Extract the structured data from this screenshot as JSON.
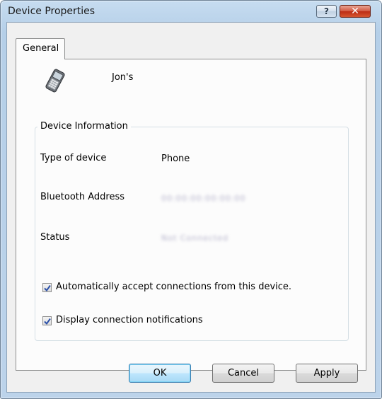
{
  "window": {
    "title": "Device Properties",
    "help_glyph": "?",
    "close_glyph": "✕"
  },
  "tabs": [
    {
      "label": "General",
      "selected": true
    }
  ],
  "device": {
    "name": "Jon's",
    "icon": "mobile-phone-icon"
  },
  "group": {
    "title": "Device Information",
    "rows": [
      {
        "label": "Type of device",
        "value": "Phone"
      },
      {
        "label": "Bluetooth Address",
        "value": "00:00:00:00:00:00"
      },
      {
        "label": "Status",
        "value": "Not Connected"
      }
    ]
  },
  "options": [
    {
      "label": "Automatically accept connections from this device.",
      "checked": true
    },
    {
      "label": "Display connection notifications",
      "checked": true
    }
  ],
  "buttons": {
    "ok": "OK",
    "cancel": "Cancel",
    "apply": "Apply"
  }
}
